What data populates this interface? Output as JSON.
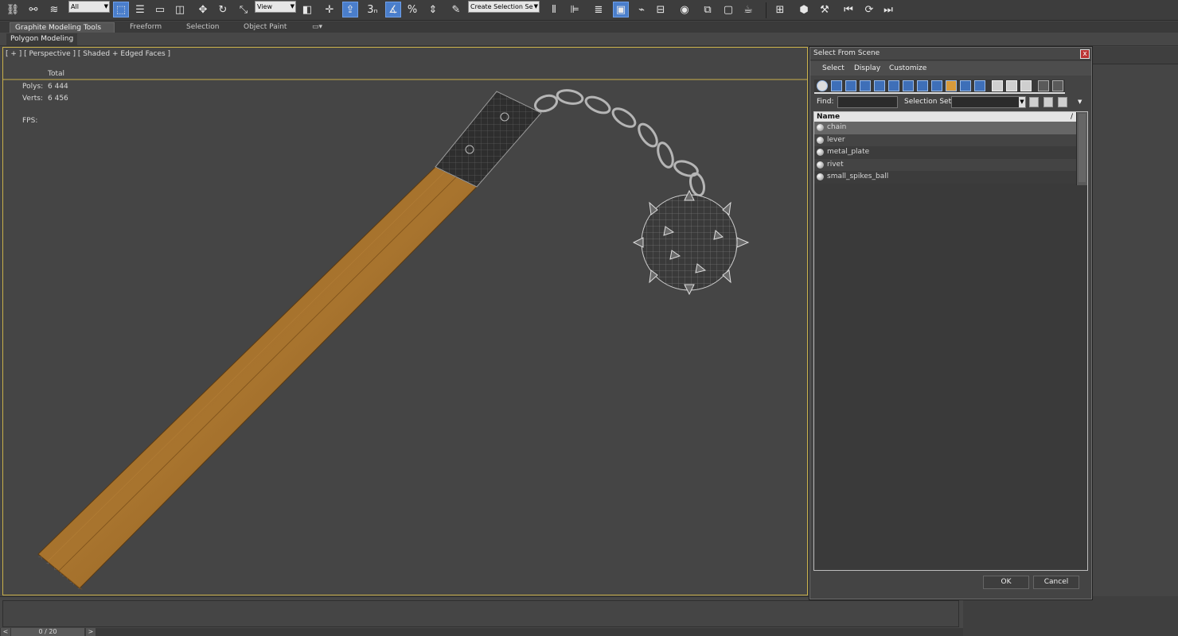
{
  "toolbar": {
    "selection_filter": "All",
    "ref_coord": "View",
    "snap_angle_label": "3",
    "named_selection": "Create Selection Se"
  },
  "ribbon": {
    "tabs": [
      "Graphite Modeling Tools",
      "Freeform",
      "Selection",
      "Object Paint"
    ],
    "panel_label": "Polygon Modeling"
  },
  "viewport": {
    "label": "[ + ] [ Perspective ] [ Shaded + Edged Faces ]",
    "stats_header": "Total",
    "polys_label": "Polys:",
    "polys_value": "6 444",
    "verts_label": "Verts:",
    "verts_value": "6 456",
    "fps_label": "FPS:"
  },
  "timeline": {
    "frame_label": "0 / 20",
    "prev": "<",
    "next": ">"
  },
  "dialog": {
    "title": "Select From Scene",
    "close": "x",
    "menu": [
      "Select",
      "Display",
      "Customize"
    ],
    "find_label": "Find:",
    "find_value": "",
    "selection_set_label": "Selection Set:",
    "column_name": "Name",
    "sort_glyph": "/",
    "objects": [
      "chain",
      "lever",
      "metal_plate",
      "rivet",
      "small_spikes_ball"
    ],
    "selected_index": 0,
    "ok_label": "OK",
    "cancel_label": "Cancel"
  },
  "colors": {
    "viewport_border": "#c9b04a",
    "stats_text": "#e4d44c",
    "wood": "#8a5a1e",
    "toolbar_active": "#4a7ecb"
  }
}
